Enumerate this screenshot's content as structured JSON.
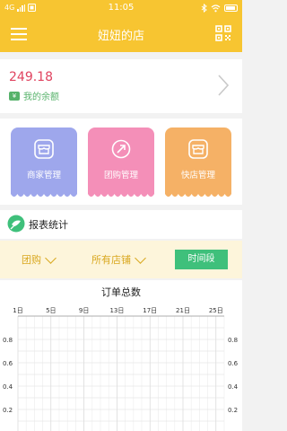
{
  "status_bar": {
    "network": "4G",
    "time": "11:05"
  },
  "header": {
    "title": "妞妞的店",
    "menu_icon": "hamburger-menu-icon",
    "scan_icon": "qr-scan-icon"
  },
  "balance": {
    "amount": "249.18",
    "label": "我的余额",
    "color": "#e0435f",
    "label_color": "#56b26a"
  },
  "tiles": [
    {
      "label": "商家管理",
      "icon": "shop-icon",
      "color": "#9ea7ec"
    },
    {
      "label": "团购管理",
      "icon": "arrow-circle-icon",
      "color": "#f48fb8"
    },
    {
      "label": "快店管理",
      "icon": "shop-icon",
      "color": "#f5b166"
    }
  ],
  "report": {
    "label": "报表统计",
    "icon": "chart-leaf-icon",
    "icon_color": "#3fc07b"
  },
  "filters": {
    "type": "团购",
    "store": "所有店铺",
    "time_button": "时间段",
    "accent": "#d9a820",
    "button_color": "#3fc07b"
  },
  "chart_data": {
    "type": "line",
    "title": "订单总数",
    "x_ticks": [
      "1日",
      "5日",
      "9日",
      "13日",
      "17日",
      "21日",
      "25日"
    ],
    "y_ticks_left": [
      "0.8",
      "0.6",
      "0.4",
      "0.2"
    ],
    "y_ticks_right": [
      "0.8",
      "0.6",
      "0.4",
      "0.2"
    ],
    "grid": true,
    "series": []
  }
}
